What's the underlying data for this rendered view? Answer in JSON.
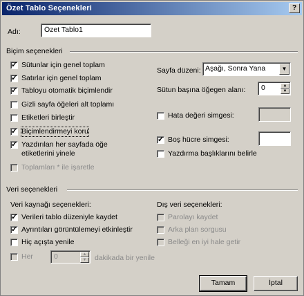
{
  "window": {
    "title": "Özet Tablo Seçenekleri",
    "help_label": "?"
  },
  "name": {
    "label": "Adı:",
    "value": "Özet Tablo1"
  },
  "format_section": {
    "heading": "Biçim seçenekleri",
    "options": [
      {
        "label": "Sütunlar için genel toplam",
        "checked": true
      },
      {
        "label": "Satırlar için genel toplam",
        "checked": true
      },
      {
        "label": "Tabloyu otomatik biçimlendir",
        "checked": true
      },
      {
        "label": "Gizli sayfa öğeleri alt toplamı",
        "checked": false
      },
      {
        "label": "Etiketleri birleştir",
        "checked": false
      },
      {
        "label": "Biçimlendirmeyi koru",
        "checked": true
      },
      {
        "label": "Yazdırılan her sayfada öğe etiketlerini yinele",
        "line1": "Yazdırılan her sayfada öğe",
        "line2": "etiketlerini yinele",
        "checked": true
      },
      {
        "label": "Toplamları * ile işaretle",
        "checked": false,
        "disabled": true
      }
    ],
    "page_layout": {
      "label": "Sayfa düzeni:",
      "value": "Aşağı, Sonra Yana"
    },
    "fields_per_column": {
      "label": "Sütun başına öğegen alanı:",
      "value": "0"
    },
    "error_values": {
      "label": "Hata değeri simgesi:",
      "checked": false,
      "value": ""
    },
    "empty_cells": {
      "label": "Boş hücre simgesi:",
      "checked": true,
      "value": ""
    },
    "print_titles": {
      "label": "Yazdırma başlıklarını belirle",
      "checked": false
    }
  },
  "data_section": {
    "heading": "Veri seçenekleri",
    "source_heading": "Veri kaynağı seçenekleri:",
    "external_heading": "Dış veri seçenekleri:",
    "source_options": [
      {
        "label": "Verileri tablo düzeniyle kaydet",
        "checked": true
      },
      {
        "label": "Ayrıntıları görüntülemeyi etkinleştir",
        "checked": true
      },
      {
        "label": "Hiç açışta yenile",
        "checked": false
      }
    ],
    "refresh_every": {
      "label": "Her",
      "value": "0",
      "suffix": "dakikada bir yenile",
      "checked": false,
      "disabled": true
    },
    "external_options": [
      {
        "label": "Parolayı kaydet",
        "checked": false,
        "disabled": true
      },
      {
        "label": "Arka plan sorgusu",
        "checked": false,
        "disabled": true
      },
      {
        "label": "Belleği en iyi hale getir",
        "checked": false,
        "disabled": true
      }
    ]
  },
  "buttons": {
    "ok": "Tamam",
    "cancel": "İptal"
  }
}
